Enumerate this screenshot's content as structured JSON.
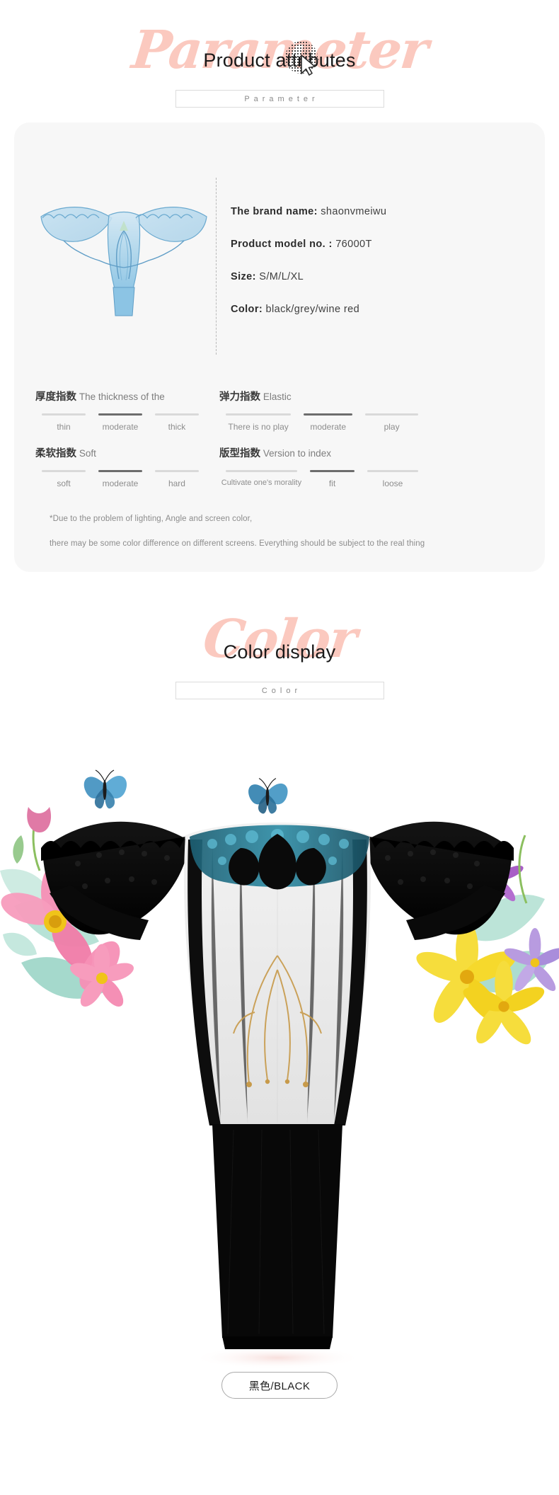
{
  "sections": {
    "parameter": {
      "watermark": "Parameter",
      "title": "Product attributes",
      "box_label": "Parameter"
    },
    "color": {
      "watermark": "Color",
      "title": "Color display",
      "box_label": "Color"
    }
  },
  "specs": [
    {
      "key": "The brand name:",
      "value": "shaonvmeiwu"
    },
    {
      "key": "Product model no. :",
      "value": "76000T"
    },
    {
      "key": "Size:",
      "value": "S/M/L/XL"
    },
    {
      "key": "Color:",
      "value": "black/grey/wine red"
    }
  ],
  "indices": [
    {
      "cn": "厚度指数",
      "en": "The thickness of the",
      "options": [
        "thin",
        "moderate",
        "thick"
      ],
      "selected": 1
    },
    {
      "cn": "弹力指数",
      "en": "Elastic",
      "options": [
        "There is no play",
        "moderate",
        "play"
      ],
      "selected": 1
    },
    {
      "cn": "柔软指数",
      "en": "Soft",
      "options": [
        "soft",
        "moderate",
        "hard"
      ],
      "selected": 1
    },
    {
      "cn": "版型指数",
      "en": "Version to index",
      "options": [
        "Cultivate one's morality",
        "fit",
        "loose"
      ],
      "selected": 1
    }
  ],
  "disclaimer": {
    "line1": "*Due to the problem of lighting, Angle and screen color,",
    "line2": "there may be some color difference on different screens. Everything should be subject to the real thing"
  },
  "color_swatch": {
    "label": "黑色/BLACK"
  },
  "colors": {
    "watermark_pink": "#fbc9bf",
    "card_background": "#f7f7f7",
    "bar_inactive": "#d9d9d9",
    "bar_active": "#6d6d6d",
    "title_text": "#1a1a1a",
    "muted_text": "#8d8d8d"
  }
}
